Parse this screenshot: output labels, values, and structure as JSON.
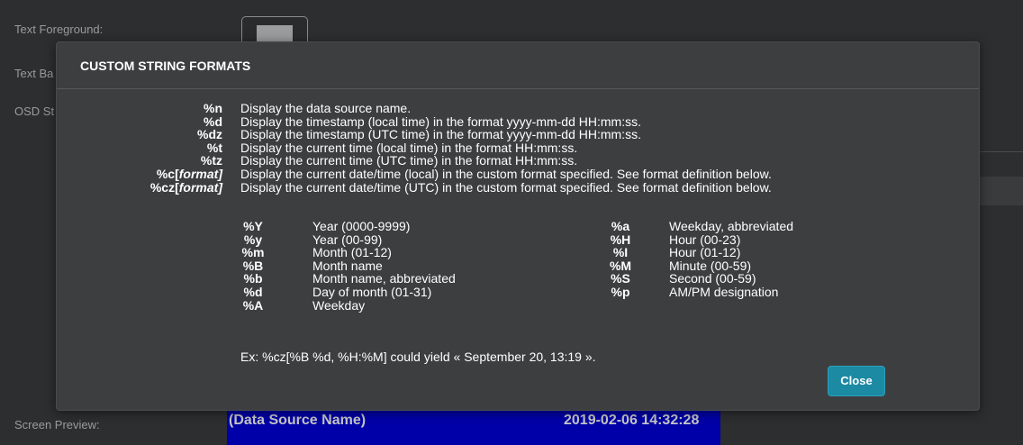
{
  "background": {
    "labels": [
      {
        "text": "Text Foreground:"
      },
      {
        "text": "Text Ba"
      },
      {
        "text": "OSD St"
      },
      {
        "text": "Screen Preview:"
      }
    ],
    "preview": {
      "source_name": "(Data Source Name)",
      "timestamp": "2019-02-06 14:32:28"
    },
    "colors": {
      "preview_bg": "#0000a8",
      "page_bg": "#2d2e30"
    }
  },
  "modal": {
    "title": "CUSTOM STRING FORMATS",
    "formats": [
      {
        "code": "%n",
        "tail": "",
        "desc": "Display the data source name."
      },
      {
        "code": "%d",
        "tail": "",
        "desc": "Display the timestamp (local time) in the format yyyy-mm-dd HH:mm:ss."
      },
      {
        "code": "%dz",
        "tail": "",
        "desc": "Display the timestamp (UTC time) in the format yyyy-mm-dd HH:mm:ss."
      },
      {
        "code": "%t",
        "tail": "",
        "desc": "Display the current time (local time) in the format HH:mm:ss."
      },
      {
        "code": "%tz",
        "tail": "",
        "desc": "Display the current time (UTC time) in the format HH:mm:ss."
      },
      {
        "code": "%c[",
        "tail": "format]",
        "desc": "Display the current date/time (local) in the custom format specified. See format definition below."
      },
      {
        "code": "%cz[",
        "tail": "format]",
        "desc": "Display the current date/time (UTC) in the custom format specified. See format definition below."
      }
    ],
    "specifiers_left": [
      {
        "k": "%Y",
        "v": "Year (0000-9999)"
      },
      {
        "k": "%y",
        "v": "Year (00-99)"
      },
      {
        "k": "%m",
        "v": "Month (01-12)"
      },
      {
        "k": "%B",
        "v": "Month name"
      },
      {
        "k": "%b",
        "v": "Month name, abbreviated"
      },
      {
        "k": "%d",
        "v": "Day of month (01-31)"
      },
      {
        "k": "%A",
        "v": "Weekday"
      }
    ],
    "specifiers_right": [
      {
        "k": "%a",
        "v": "Weekday, abbreviated"
      },
      {
        "k": "%H",
        "v": "Hour (00-23)"
      },
      {
        "k": "%I",
        "v": "Hour (01-12)"
      },
      {
        "k": "%M",
        "v": "Minute (00-59)"
      },
      {
        "k": "%S",
        "v": "Second (00-59)"
      },
      {
        "k": "%p",
        "v": "AM/PM designation"
      }
    ],
    "example": "Ex: %cz[%B %d, %H:%M] could yield « September 20, 13:19 ».",
    "close_label": "Close",
    "colors": {
      "accent": "#1d8aa4",
      "modal_bg": "#3d3e40"
    }
  }
}
